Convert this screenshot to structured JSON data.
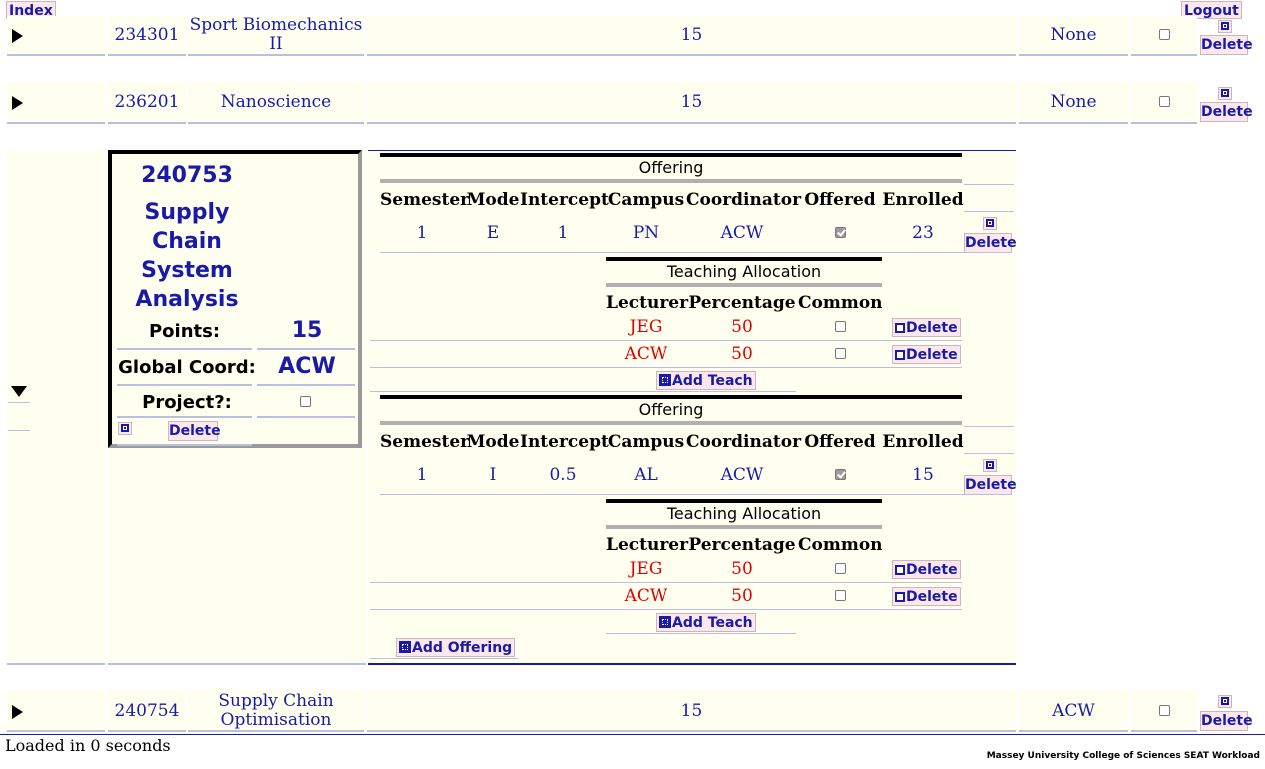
{
  "header": {
    "index_label": "Index",
    "logout_label": "Logout"
  },
  "rows": [
    {
      "code": "234301",
      "title": "Sport Biomechanics II",
      "points": "15",
      "coordinator": "None",
      "delete_label": "Delete"
    },
    {
      "code": "236201",
      "title": "Nanoscience",
      "points": "15",
      "coordinator": "None",
      "delete_label": "Delete"
    },
    {
      "code": "240754",
      "title": "Supply Chain Optimisation",
      "points": "15",
      "coordinator": "ACW",
      "delete_label": "Delete"
    }
  ],
  "expanded": {
    "code": "240753",
    "title": "Supply Chain System Analysis",
    "points_label": "Points:",
    "points": "15",
    "coord_label": "Global Coord:",
    "coord": "ACW",
    "project_label": "Project?:",
    "delete_label": "Delete",
    "offering_title": "Offering",
    "offering_headers": [
      "Semester",
      "Mode",
      "Intercept",
      "Campus",
      "Coordinator",
      "Offered",
      "Enrolled"
    ],
    "teach_title": "Teaching Allocation",
    "teach_headers": [
      "Lecturer",
      "Percentage",
      "Common"
    ],
    "add_teach_label": "Add Teach",
    "add_offering_label": "Add Offering",
    "offerings": [
      {
        "semester": "1",
        "mode": "E",
        "intercept": "1",
        "campus": "PN",
        "coordinator": "ACW",
        "enrolled": "23",
        "teaching": [
          {
            "lecturer": "JEG",
            "percentage": "50"
          },
          {
            "lecturer": "ACW",
            "percentage": "50"
          }
        ]
      },
      {
        "semester": "1",
        "mode": "I",
        "intercept": "0.5",
        "campus": "AL",
        "coordinator": "ACW",
        "enrolled": "15",
        "teaching": [
          {
            "lecturer": "JEG",
            "percentage": "50"
          },
          {
            "lecturer": "ACW",
            "percentage": "50"
          }
        ]
      }
    ]
  },
  "footer": {
    "status": "Loaded in 0 seconds",
    "credit": "Massey University College of Sciences SEAT Workload"
  }
}
